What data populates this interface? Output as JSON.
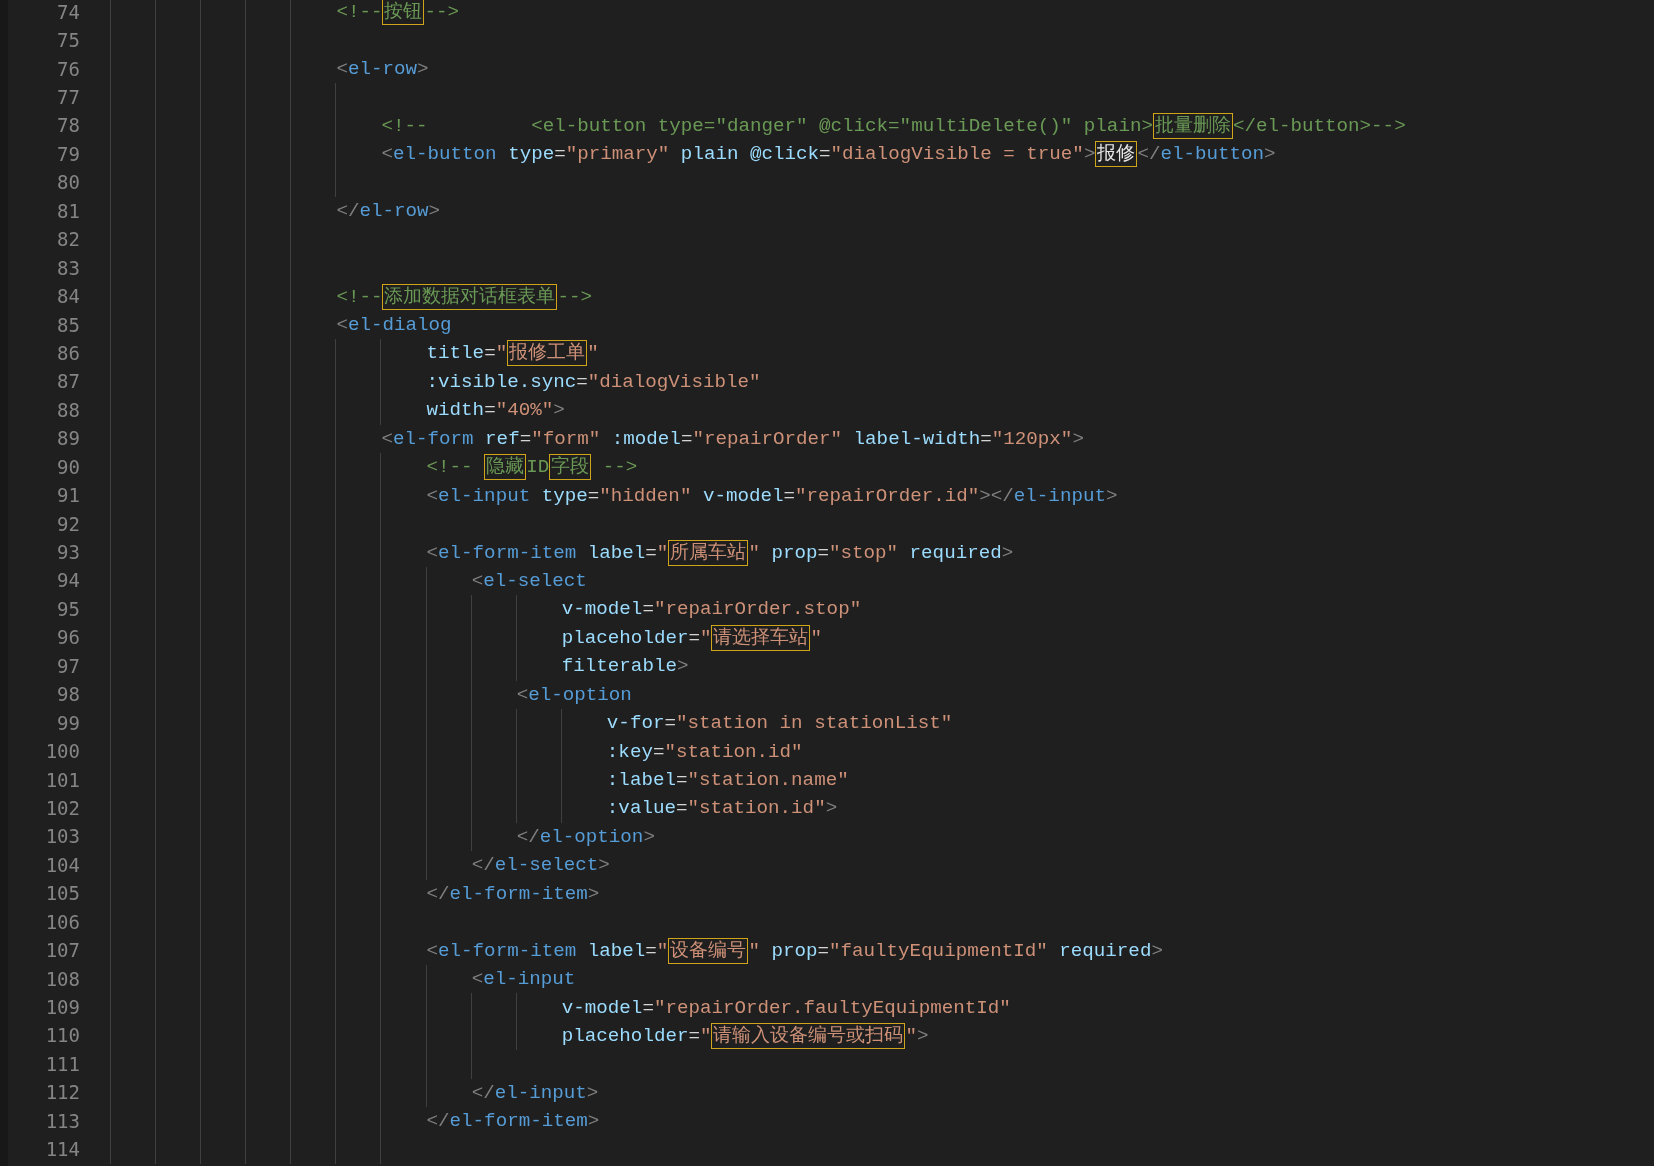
{
  "lines": [
    {
      "n": "74",
      "tokens": [
        {
          "kind": "com",
          "t": "<!--"
        },
        {
          "kind": "com-box",
          "t": "按钮"
        },
        {
          "kind": "com",
          "t": "-->"
        }
      ]
    },
    {
      "n": "75"
    },
    {
      "n": "76",
      "tokens": [
        {
          "kind": "p",
          "t": "<"
        },
        {
          "kind": "tag",
          "t": "el-row"
        },
        {
          "kind": "p",
          "t": ">"
        }
      ]
    },
    {
      "children": [
        {
          "n": "77"
        },
        {
          "n": "78",
          "tokens": [
            {
              "kind": "com",
              "t": "<!--         <el-button type=\"danger\" @click=\"multiDelete()\" plain>"
            },
            {
              "kind": "com-box",
              "t": "批量删除"
            },
            {
              "kind": "com",
              "t": "</el-button>-->"
            }
          ]
        },
        {
          "n": "79",
          "tokens": [
            {
              "kind": "p",
              "t": "<"
            },
            {
              "kind": "tag",
              "t": "el-button"
            },
            {
              "kind": "attr",
              "t": " type"
            },
            {
              "kind": "eq",
              "t": "="
            },
            {
              "kind": "str",
              "t": "\"primary\""
            },
            {
              "kind": "attr",
              "t": " plain @click"
            },
            {
              "kind": "eq",
              "t": "="
            },
            {
              "kind": "str",
              "t": "\"dialogVisible = true\""
            },
            {
              "kind": "p",
              "t": ">"
            },
            {
              "kind": "text-box",
              "t": "报修"
            },
            {
              "kind": "p",
              "t": "</"
            },
            {
              "kind": "tag",
              "t": "el-button"
            },
            {
              "kind": "p",
              "t": ">"
            }
          ]
        },
        {
          "n": "80"
        }
      ]
    },
    {
      "n": "81",
      "tokens": [
        {
          "kind": "p",
          "t": "</"
        },
        {
          "kind": "tag",
          "t": "el-row"
        },
        {
          "kind": "p",
          "t": ">"
        }
      ]
    },
    {
      "n": "82"
    },
    {
      "n": "83"
    },
    {
      "n": "84",
      "tokens": [
        {
          "kind": "com",
          "t": "<!--"
        },
        {
          "kind": "com-box",
          "t": "添加数据对话框表单"
        },
        {
          "kind": "com",
          "t": "-->"
        }
      ]
    },
    {
      "n": "85",
      "tokens": [
        {
          "kind": "p",
          "t": "<"
        },
        {
          "kind": "tag",
          "t": "el-dialog"
        }
      ]
    },
    {
      "children": [
        {
          "children": [
            {
              "n": "86",
              "tokens": [
                {
                  "kind": "attr",
                  "t": "title"
                },
                {
                  "kind": "eq",
                  "t": "="
                },
                {
                  "kind": "str",
                  "t": "\""
                },
                {
                  "kind": "str-box",
                  "t": "报修工单"
                },
                {
                  "kind": "str",
                  "t": "\""
                }
              ]
            },
            {
              "n": "87",
              "tokens": [
                {
                  "kind": "attr",
                  "t": ":visible.sync"
                },
                {
                  "kind": "eq",
                  "t": "="
                },
                {
                  "kind": "str",
                  "t": "\"dialogVisible\""
                }
              ]
            },
            {
              "n": "88",
              "tokens": [
                {
                  "kind": "attr",
                  "t": "width"
                },
                {
                  "kind": "eq",
                  "t": "="
                },
                {
                  "kind": "str",
                  "t": "\"40%\""
                },
                {
                  "kind": "p",
                  "t": ">"
                }
              ]
            }
          ]
        },
        {
          "n": "89",
          "tokens": [
            {
              "kind": "p",
              "t": "<"
            },
            {
              "kind": "tag",
              "t": "el-form"
            },
            {
              "kind": "attr",
              "t": " ref"
            },
            {
              "kind": "eq",
              "t": "="
            },
            {
              "kind": "str",
              "t": "\"form\""
            },
            {
              "kind": "attr",
              "t": " :model"
            },
            {
              "kind": "eq",
              "t": "="
            },
            {
              "kind": "str",
              "t": "\"repairOrder\""
            },
            {
              "kind": "attr",
              "t": " label-width"
            },
            {
              "kind": "eq",
              "t": "="
            },
            {
              "kind": "str",
              "t": "\"120px\""
            },
            {
              "kind": "p",
              "t": ">"
            }
          ]
        },
        {
          "children": [
            {
              "n": "90",
              "tokens": [
                {
                  "kind": "com",
                  "t": "<!-- "
                },
                {
                  "kind": "com-box",
                  "t": "隐藏"
                },
                {
                  "kind": "com",
                  "t": "ID"
                },
                {
                  "kind": "com-box",
                  "t": "字段"
                },
                {
                  "kind": "com",
                  "t": " -->"
                }
              ]
            },
            {
              "n": "91",
              "tokens": [
                {
                  "kind": "p",
                  "t": "<"
                },
                {
                  "kind": "tag",
                  "t": "el-input"
                },
                {
                  "kind": "attr",
                  "t": " type"
                },
                {
                  "kind": "eq",
                  "t": "="
                },
                {
                  "kind": "str",
                  "t": "\"hidden\""
                },
                {
                  "kind": "attr",
                  "t": " v-model"
                },
                {
                  "kind": "eq",
                  "t": "="
                },
                {
                  "kind": "str",
                  "t": "\"repairOrder.id\""
                },
                {
                  "kind": "p",
                  "t": "></"
                },
                {
                  "kind": "tag",
                  "t": "el-input"
                },
                {
                  "kind": "p",
                  "t": ">"
                }
              ]
            },
            {
              "n": "92"
            },
            {
              "n": "93",
              "tokens": [
                {
                  "kind": "p",
                  "t": "<"
                },
                {
                  "kind": "tag",
                  "t": "el-form-item"
                },
                {
                  "kind": "attr",
                  "t": " label"
                },
                {
                  "kind": "eq",
                  "t": "="
                },
                {
                  "kind": "str",
                  "t": "\""
                },
                {
                  "kind": "str-box",
                  "t": "所属车站"
                },
                {
                  "kind": "str",
                  "t": "\""
                },
                {
                  "kind": "attr",
                  "t": " prop"
                },
                {
                  "kind": "eq",
                  "t": "="
                },
                {
                  "kind": "str",
                  "t": "\"stop\""
                },
                {
                  "kind": "attr",
                  "t": " required"
                },
                {
                  "kind": "p",
                  "t": ">"
                }
              ]
            },
            {
              "children": [
                {
                  "n": "94",
                  "tokens": [
                    {
                      "kind": "p",
                      "t": "<"
                    },
                    {
                      "kind": "tag",
                      "t": "el-select"
                    }
                  ]
                },
                {
                  "children": [
                    {
                      "children": [
                        {
                          "n": "95",
                          "tokens": [
                            {
                              "kind": "attr",
                              "t": "v-model"
                            },
                            {
                              "kind": "eq",
                              "t": "="
                            },
                            {
                              "kind": "str",
                              "t": "\"repairOrder.stop\""
                            }
                          ]
                        },
                        {
                          "n": "96",
                          "tokens": [
                            {
                              "kind": "attr",
                              "t": "placeholder"
                            },
                            {
                              "kind": "eq",
                              "t": "="
                            },
                            {
                              "kind": "str",
                              "t": "\""
                            },
                            {
                              "kind": "str-box",
                              "t": "请选择车站"
                            },
                            {
                              "kind": "str",
                              "t": "\""
                            }
                          ]
                        },
                        {
                          "n": "97",
                          "tokens": [
                            {
                              "kind": "attr",
                              "t": "filterable"
                            },
                            {
                              "kind": "p",
                              "t": ">"
                            }
                          ]
                        }
                      ]
                    },
                    {
                      "n": "98",
                      "tokens": [
                        {
                          "kind": "p",
                          "t": "<"
                        },
                        {
                          "kind": "tag",
                          "t": "el-option"
                        }
                      ]
                    },
                    {
                      "children": [
                        {
                          "children": [
                            {
                              "n": "99",
                              "tokens": [
                                {
                                  "kind": "attr",
                                  "t": "v-for"
                                },
                                {
                                  "kind": "eq",
                                  "t": "="
                                },
                                {
                                  "kind": "str",
                                  "t": "\"station in stationList\""
                                }
                              ]
                            },
                            {
                              "n": "100",
                              "tokens": [
                                {
                                  "kind": "attr",
                                  "t": ":key"
                                },
                                {
                                  "kind": "eq",
                                  "t": "="
                                },
                                {
                                  "kind": "str",
                                  "t": "\"station.id\""
                                }
                              ]
                            },
                            {
                              "n": "101",
                              "tokens": [
                                {
                                  "kind": "attr",
                                  "t": ":label"
                                },
                                {
                                  "kind": "eq",
                                  "t": "="
                                },
                                {
                                  "kind": "str",
                                  "t": "\"station.name\""
                                }
                              ]
                            },
                            {
                              "n": "102",
                              "tokens": [
                                {
                                  "kind": "attr",
                                  "t": ":value"
                                },
                                {
                                  "kind": "eq",
                                  "t": "="
                                },
                                {
                                  "kind": "str",
                                  "t": "\"station.id\""
                                },
                                {
                                  "kind": "p",
                                  "t": ">"
                                }
                              ]
                            }
                          ]
                        }
                      ]
                    },
                    {
                      "n": "103",
                      "tokens": [
                        {
                          "kind": "p",
                          "t": "</"
                        },
                        {
                          "kind": "tag",
                          "t": "el-option"
                        },
                        {
                          "kind": "p",
                          "t": ">"
                        }
                      ]
                    }
                  ]
                },
                {
                  "n": "104",
                  "tokens": [
                    {
                      "kind": "p",
                      "t": "</"
                    },
                    {
                      "kind": "tag",
                      "t": "el-select"
                    },
                    {
                      "kind": "p",
                      "t": ">"
                    }
                  ]
                }
              ]
            },
            {
              "n": "105",
              "tokens": [
                {
                  "kind": "p",
                  "t": "</"
                },
                {
                  "kind": "tag",
                  "t": "el-form-item"
                },
                {
                  "kind": "p",
                  "t": ">"
                }
              ]
            },
            {
              "n": "106"
            },
            {
              "n": "107",
              "tokens": [
                {
                  "kind": "p",
                  "t": "<"
                },
                {
                  "kind": "tag",
                  "t": "el-form-item"
                },
                {
                  "kind": "attr",
                  "t": " label"
                },
                {
                  "kind": "eq",
                  "t": "="
                },
                {
                  "kind": "str",
                  "t": "\""
                },
                {
                  "kind": "str-box",
                  "t": "设备编号"
                },
                {
                  "kind": "str",
                  "t": "\""
                },
                {
                  "kind": "attr",
                  "t": " prop"
                },
                {
                  "kind": "eq",
                  "t": "="
                },
                {
                  "kind": "str",
                  "t": "\"faultyEquipmentId\""
                },
                {
                  "kind": "attr",
                  "t": " required"
                },
                {
                  "kind": "p",
                  "t": ">"
                }
              ]
            },
            {
              "children": [
                {
                  "n": "108",
                  "tokens": [
                    {
                      "kind": "p",
                      "t": "<"
                    },
                    {
                      "kind": "tag",
                      "t": "el-input"
                    }
                  ]
                },
                {
                  "children": [
                    {
                      "children": [
                        {
                          "n": "109",
                          "tokens": [
                            {
                              "kind": "attr",
                              "t": "v-model"
                            },
                            {
                              "kind": "eq",
                              "t": "="
                            },
                            {
                              "kind": "str",
                              "t": "\"repairOrder.faultyEquipmentId\""
                            }
                          ]
                        },
                        {
                          "n": "110",
                          "tokens": [
                            {
                              "kind": "attr",
                              "t": "placeholder"
                            },
                            {
                              "kind": "eq",
                              "t": "="
                            },
                            {
                              "kind": "str",
                              "t": "\""
                            },
                            {
                              "kind": "str-box",
                              "t": "请输入设备编号或扫码"
                            },
                            {
                              "kind": "str",
                              "t": "\""
                            },
                            {
                              "kind": "p",
                              "t": ">"
                            }
                          ]
                        }
                      ]
                    },
                    {
                      "n": "111"
                    }
                  ]
                },
                {
                  "n": "112",
                  "tokens": [
                    {
                      "kind": "p",
                      "t": "</"
                    },
                    {
                      "kind": "tag",
                      "t": "el-input"
                    },
                    {
                      "kind": "p",
                      "t": ">"
                    }
                  ]
                }
              ]
            },
            {
              "n": "113",
              "tokens": [
                {
                  "kind": "p",
                  "t": "</"
                },
                {
                  "kind": "tag",
                  "t": "el-form-item"
                },
                {
                  "kind": "p",
                  "t": ">"
                }
              ]
            },
            {
              "n": "114"
            }
          ]
        }
      ]
    }
  ]
}
